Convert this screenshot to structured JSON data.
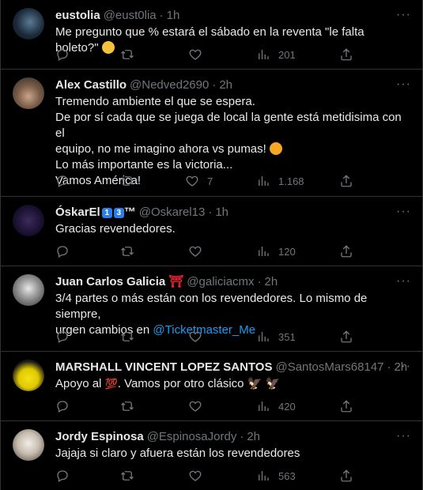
{
  "tweets": [
    {
      "name": "eustolia",
      "handle": "@eust0lia",
      "time": "1h",
      "text": "Me pregunto que % estará el sábado en la reventa \"le falta boleto?\"",
      "views": "201",
      "likes": ""
    },
    {
      "name": "Alex Castillo",
      "handle": "@Nedved2690",
      "time": "2h",
      "lines": [
        "Tremendo ambiente el que se espera.",
        "De por sí cada que se juega de local la gente está metidisima con el",
        "equipo, no me imagino ahora vs pumas!",
        "Lo más importante es la victoria...",
        "Vamos América!"
      ],
      "likes": "7",
      "views": "1.168"
    },
    {
      "name": "ÓskarEl",
      "badge1": "1",
      "badge2": "3",
      "tm": "™",
      "handle": "@Oskarel13",
      "time": "1h",
      "text": "Gracias revendedores.",
      "views": "120"
    },
    {
      "name": "Juan Carlos Galicia",
      "gate": "⛩",
      "handle": "@galiciacmx",
      "time": "2h",
      "line1": "3/4 partes o más están con los revendedores. Lo mismo de siempre,",
      "line2_prefix": "urgen cambios en ",
      "mention": "@Ticketmaster_Me",
      "views": "351"
    },
    {
      "name": "MARSHALL VINCENT LOPEZ SANTOS",
      "handle": "@SantosMars68147",
      "time": "2h",
      "text_a": "Apoyo al ",
      "hundred": "💯",
      "text_b": ". Vamos por otro clásico ",
      "eagles": "🦅 🦅",
      "views": "420"
    },
    {
      "name": "Jordy Espinosa",
      "handle": "@EspinosaJordy",
      "time": "2h",
      "text": "Jajaja si claro y afuera están los revendedores",
      "views": "563"
    }
  ],
  "dot": "·",
  "more": "···",
  "colors": {
    "background": "#000000",
    "text": "#e7e9ea",
    "muted": "#71767b",
    "link": "#1d9bf0",
    "divider": "#2f3336"
  },
  "icons": [
    "reply-icon",
    "retweet-icon",
    "like-icon",
    "views-icon",
    "share-icon"
  ]
}
